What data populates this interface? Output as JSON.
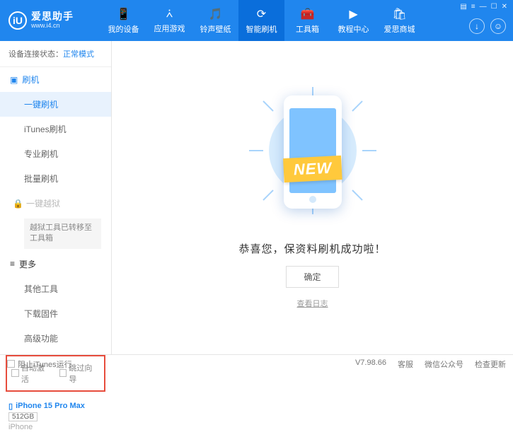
{
  "header": {
    "logo_text": "iU",
    "logo_main": "爱思助手",
    "logo_sub": "www.i4.cn",
    "nav": [
      {
        "icon": "📱",
        "label": "我的设备"
      },
      {
        "icon": "⩑",
        "label": "应用游戏"
      },
      {
        "icon": "🎵",
        "label": "铃声壁纸"
      },
      {
        "icon": "⟳",
        "label": "智能刷机",
        "active": true
      },
      {
        "icon": "🧰",
        "label": "工具箱"
      },
      {
        "icon": "▶",
        "label": "教程中心"
      },
      {
        "icon": "🛍",
        "label": "爱思商城"
      }
    ],
    "win_controls": [
      "▤",
      "≡",
      "—",
      "☐",
      "✕"
    ]
  },
  "sidebar": {
    "status_label": "设备连接状态：",
    "status_value": "正常模式",
    "sec_flash": {
      "title": "刷机",
      "items": [
        "一键刷机",
        "iTunes刷机",
        "专业刷机",
        "批量刷机"
      ]
    },
    "sec_jail": {
      "title": "一键越狱",
      "note": "越狱工具已转移至工具箱"
    },
    "sec_more": {
      "title": "更多",
      "items": [
        "其他工具",
        "下载固件",
        "高级功能"
      ]
    },
    "checkboxes": {
      "auto_activate": "自动激活",
      "skip_guide": "跳过向导"
    },
    "device": {
      "name": "iPhone 15 Pro Max",
      "storage": "512GB",
      "type": "iPhone"
    }
  },
  "main": {
    "ribbon": "NEW",
    "success": "恭喜您，保资料刷机成功啦！",
    "ok": "确定",
    "log": "查看日志"
  },
  "footer": {
    "block_itunes": "阻止iTunes运行",
    "version": "V7.98.66",
    "links": [
      "客服",
      "微信公众号",
      "检查更新"
    ]
  }
}
